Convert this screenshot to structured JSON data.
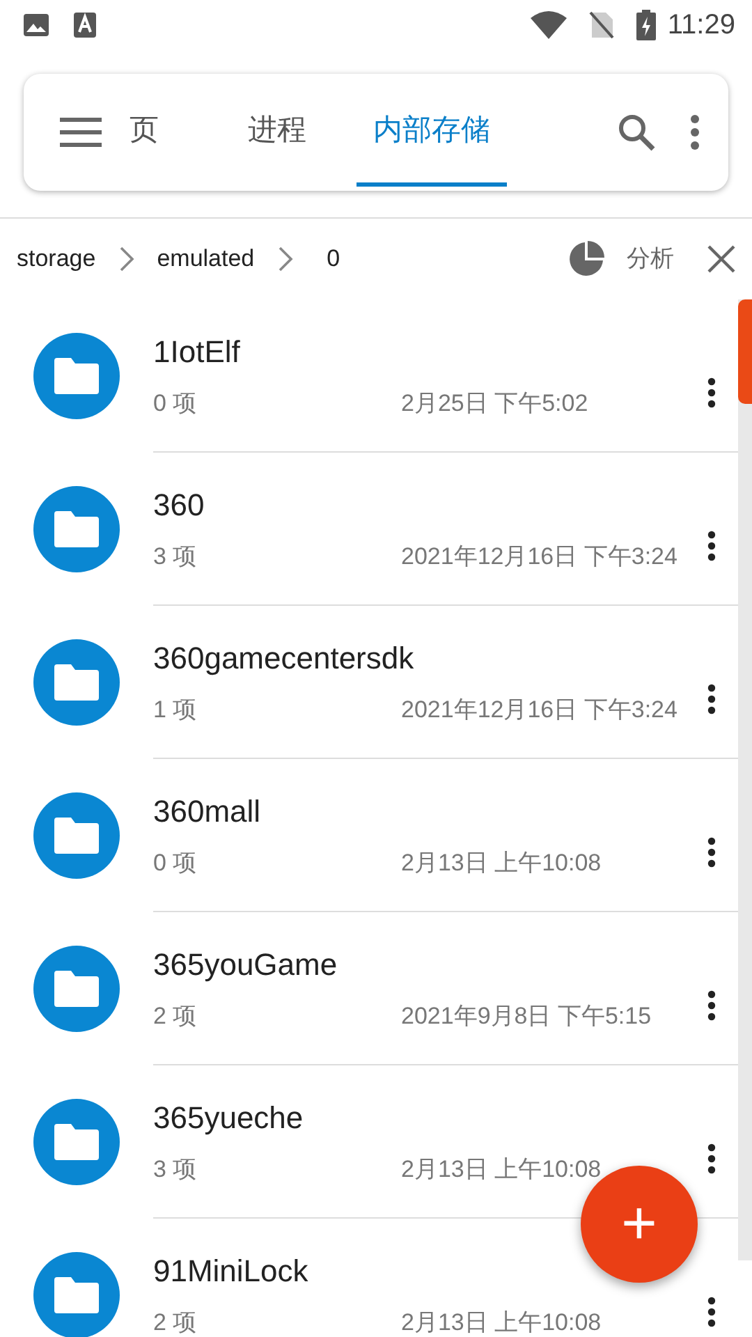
{
  "status_bar": {
    "time": "11:29"
  },
  "tabs": [
    {
      "label": "页",
      "selected": false
    },
    {
      "label": "进程",
      "selected": false
    },
    {
      "label": "内部存储",
      "selected": true
    }
  ],
  "breadcrumb": [
    "storage",
    "emulated",
    "0"
  ],
  "analyze_label": "分析",
  "files": [
    {
      "name": "1IotElf",
      "count": "0 项",
      "date": "2月25日 下午5:02"
    },
    {
      "name": "360",
      "count": "3 项",
      "date": "2021年12月16日 下午3:24"
    },
    {
      "name": "360gamecentersdk",
      "count": "1 项",
      "date": "2021年12月16日 下午3:24"
    },
    {
      "name": "360mall",
      "count": "0 项",
      "date": "2月13日 上午10:08"
    },
    {
      "name": "365youGame",
      "count": "2 项",
      "date": "2021年9月8日 下午5:15"
    },
    {
      "name": "365yueche",
      "count": "3 项",
      "date": "2月13日 上午10:08"
    },
    {
      "name": "91MiniLock",
      "count": "2 项",
      "date": "2月13日 上午10:08"
    }
  ],
  "fab": {
    "label": "+"
  }
}
